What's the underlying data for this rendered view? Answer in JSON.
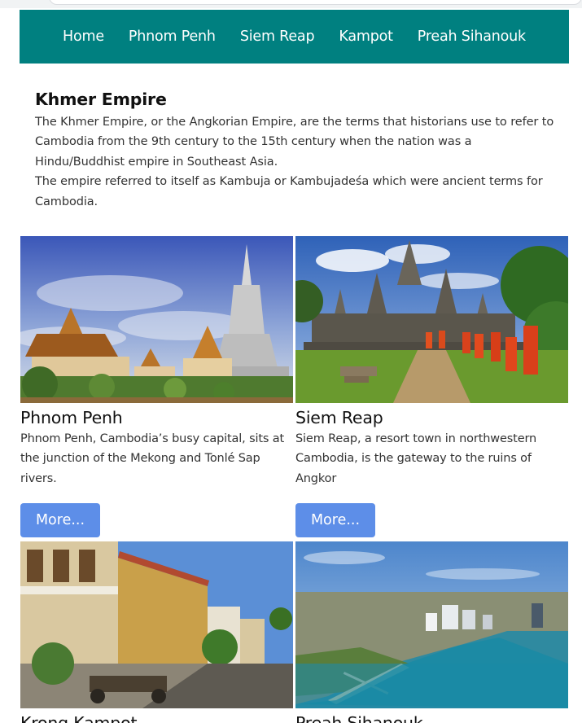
{
  "nav": {
    "items": [
      "Home",
      "Phnom Penh",
      "Siem Reap",
      "Kampot",
      "Preah Sihanouk"
    ]
  },
  "intro": {
    "title": "Khmer Empire",
    "paragraph1": "The Khmer Empire, or the Angkorian Empire, are the terms that historians use to refer to Cambodia from the 9th century to the 15th century when the nation was a Hindu/Buddhist empire in Southeast Asia.",
    "paragraph2": "The empire referred to itself as Kambuja or Kambujadeśa which were ancient terms for Cambodia."
  },
  "cards": [
    {
      "title": "Phnom Penh",
      "description": "Phnom Penh, Cambodia’s busy capital, sits at the junction of the Mekong and Tonlé Sap rivers.",
      "button": "More..."
    },
    {
      "title": "Siem Reap",
      "description": "Siem Reap, a resort town in northwestern Cambodia, is the gateway to the ruins of Angkor",
      "button": "More..."
    },
    {
      "title": "Krong Kampot"
    },
    {
      "title": "Preah Sihanouk"
    }
  ],
  "colors": {
    "navbar": "#008080",
    "button": "#5d8ee8"
  }
}
